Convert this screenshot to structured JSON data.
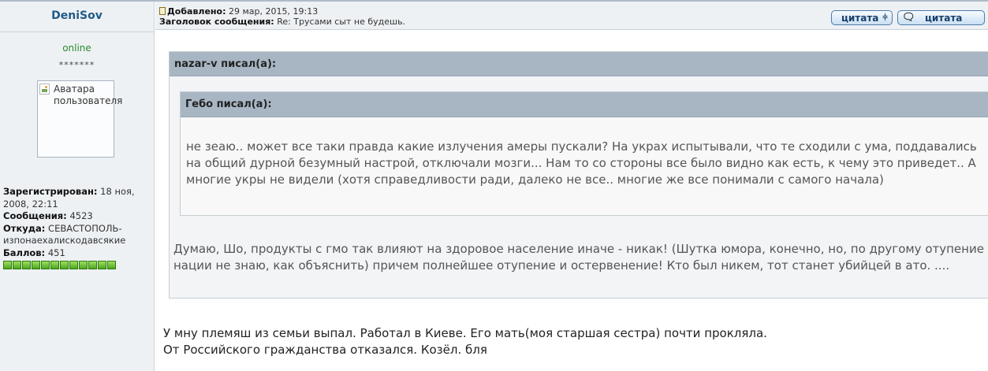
{
  "author": {
    "username": "DeniSov",
    "status": "online",
    "stars": "*******",
    "avatar_alt": "Аватара пользователя",
    "registered_label": "Зарегистрирован:",
    "registered_value": "18 ноя, 2008, 22:11",
    "messages_label": "Сообщения:",
    "messages_value": "4523",
    "from_label": "Откуда:",
    "from_value": "СЕВАСТОПОЛЬ-изпонаехалиско​давсякие",
    "points_label": "Баллов:",
    "points_value": "451",
    "rank_pips": 12
  },
  "post": {
    "added_label": "Добавлено:",
    "added_value": "29 мар, 2015, 19:13",
    "subject_label": "Заголовок сообщения:",
    "subject_value": "Re: Трусами сыт не будешь.",
    "buttons": {
      "multiquote": "цитата",
      "quote": "цитата"
    },
    "quote_outer": {
      "author": "nazar-v писал(а):",
      "text": "Думаю, Шо, продукты с гмо так влияют на здоровое население иначе - никак! (Шутка юмора, конечно, но, по другому отупение нации не знаю, как объяснить) причем полнейшее отупение и остервенение! Кто был никем, тот станет убийцей в ато. ...."
    },
    "quote_inner": {
      "author": "Гебо писал(а):",
      "text": "не зеаю.. может все таки правда какие излучения амеры пускали? На украх испытывали, что те сходили с ума, поддавались на общий дурной безумный настрой, отключали мозги... Нам то со стороны все было видно как есть, к чему это приведет.. А многие укры не видели (хотя справедливости ради, далеко не все.. многие же все понимали с самого начала)"
    },
    "body": "У мну племяш из семьи выпал. Работал в Киеве. Его мать(моя старшая сестра) почти прокляла.\nОт Российского гражданства отказался. Козёл. бля"
  },
  "colors": {
    "panel_bg": "#eef1f4",
    "quote_header": "#a8b6c4",
    "username": "#205b87",
    "online": "#2a8b2a"
  }
}
